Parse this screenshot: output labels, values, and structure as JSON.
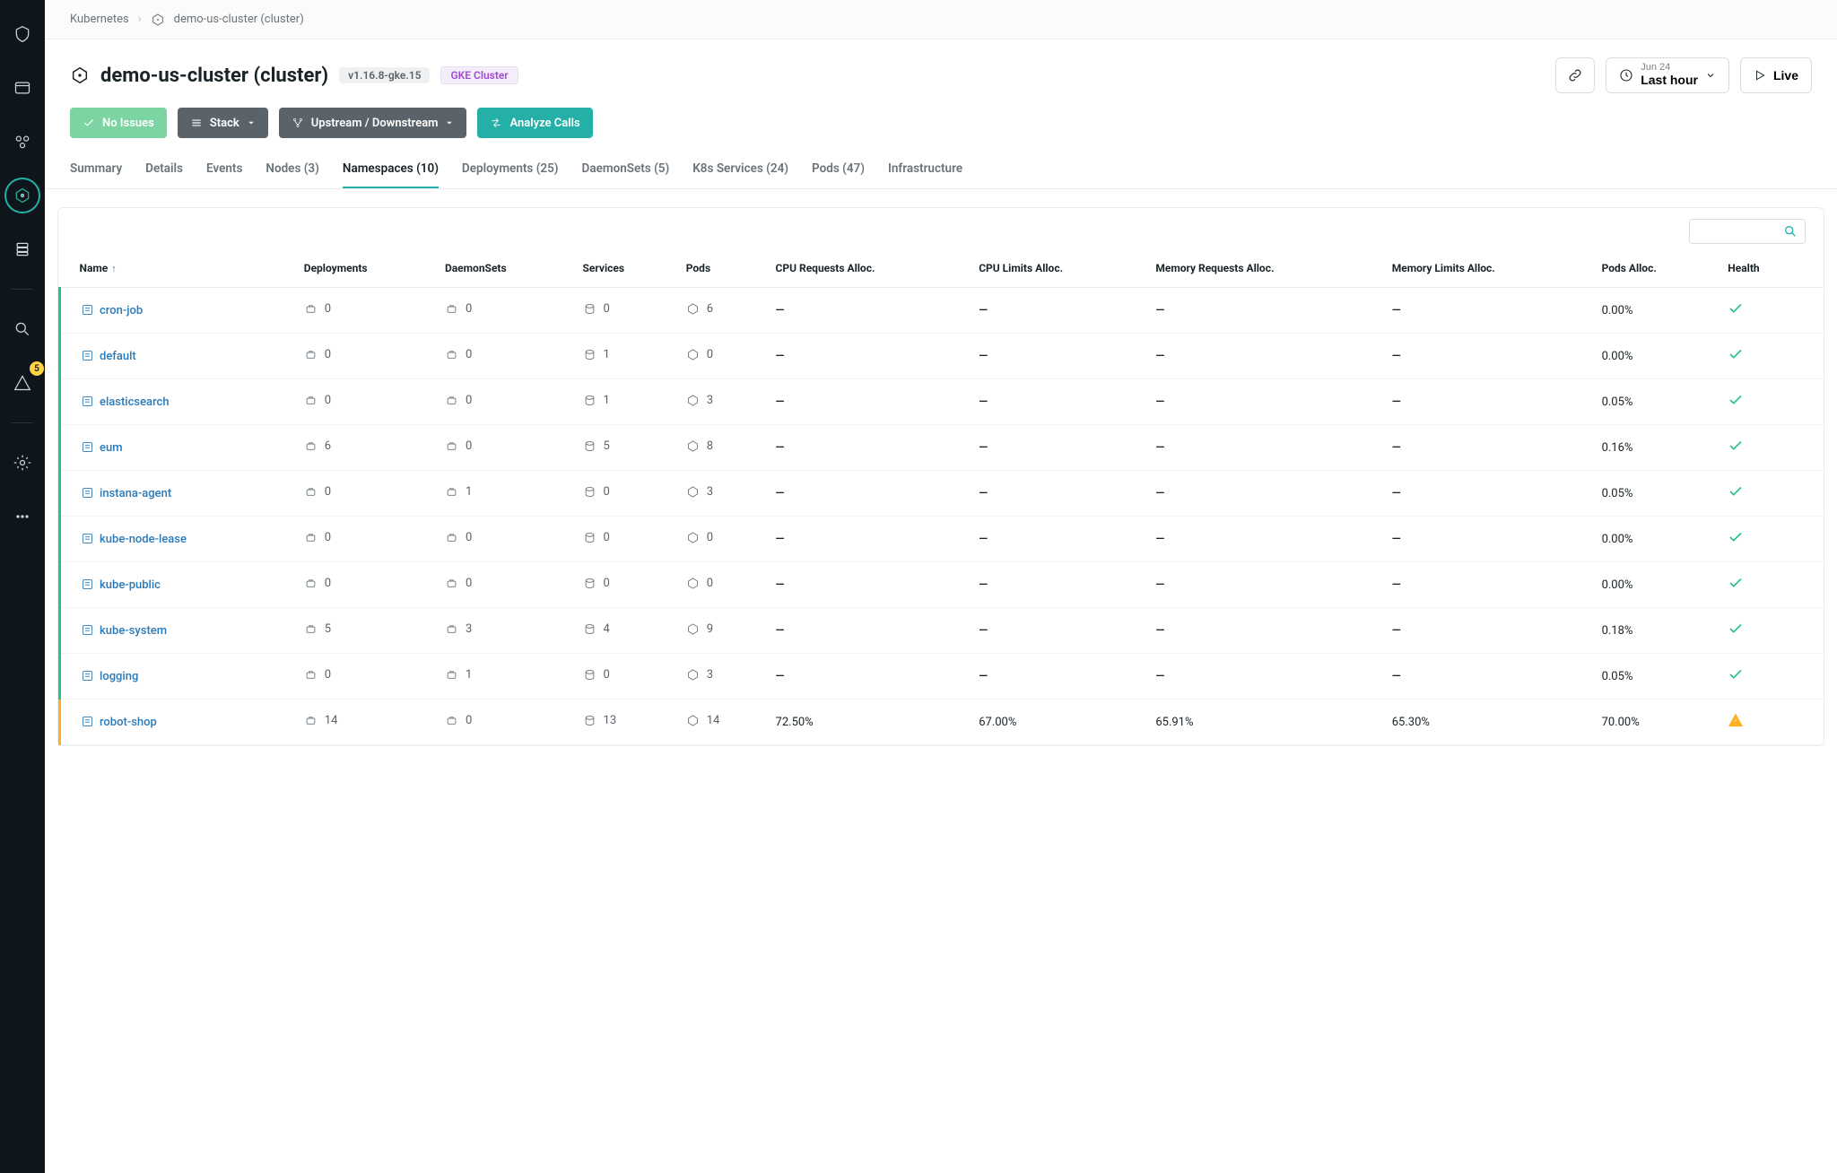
{
  "rail": {
    "badge_count": "5"
  },
  "breadcrumb": {
    "root": "Kubernetes",
    "current": "demo-us-cluster (cluster)"
  },
  "header": {
    "title": "demo-us-cluster (cluster)",
    "version_pill": "v1.16.8-gke.15",
    "type_pill": "GKE Cluster",
    "time": {
      "sup": "Jun 24",
      "main": "Last hour"
    },
    "live_label": "Live"
  },
  "actions": {
    "no_issues": "No Issues",
    "stack": "Stack",
    "upstream": "Upstream / Downstream",
    "analyze": "Analyze Calls"
  },
  "tabs": [
    {
      "label": "Summary",
      "active": false
    },
    {
      "label": "Details",
      "active": false
    },
    {
      "label": "Events",
      "active": false
    },
    {
      "label": "Nodes (3)",
      "active": false
    },
    {
      "label": "Namespaces (10)",
      "active": true
    },
    {
      "label": "Deployments (25)",
      "active": false
    },
    {
      "label": "DaemonSets (5)",
      "active": false
    },
    {
      "label": "K8s Services (24)",
      "active": false
    },
    {
      "label": "Pods (47)",
      "active": false
    },
    {
      "label": "Infrastructure",
      "active": false
    }
  ],
  "table": {
    "columns": {
      "name": "Name",
      "deployments": "Deployments",
      "daemonsets": "DaemonSets",
      "services": "Services",
      "pods": "Pods",
      "cpu_req": "CPU Requests Alloc.",
      "cpu_lim": "CPU Limits Alloc.",
      "mem_req": "Memory Requests Alloc.",
      "mem_lim": "Memory Limits Alloc.",
      "pods_alloc": "Pods Alloc.",
      "health": "Health"
    },
    "rows": [
      {
        "name": "cron-job",
        "deployments": "0",
        "daemonsets": "0",
        "services": "0",
        "pods": "6",
        "cpu_req": "—",
        "cpu_lim": "—",
        "mem_req": "—",
        "mem_lim": "—",
        "pods_alloc": "0.00%",
        "health": "ok"
      },
      {
        "name": "default",
        "deployments": "0",
        "daemonsets": "0",
        "services": "1",
        "pods": "0",
        "cpu_req": "—",
        "cpu_lim": "—",
        "mem_req": "—",
        "mem_lim": "—",
        "pods_alloc": "0.00%",
        "health": "ok"
      },
      {
        "name": "elasticsearch",
        "deployments": "0",
        "daemonsets": "0",
        "services": "1",
        "pods": "3",
        "cpu_req": "—",
        "cpu_lim": "—",
        "mem_req": "—",
        "mem_lim": "—",
        "pods_alloc": "0.05%",
        "health": "ok"
      },
      {
        "name": "eum",
        "deployments": "6",
        "daemonsets": "0",
        "services": "5",
        "pods": "8",
        "cpu_req": "—",
        "cpu_lim": "—",
        "mem_req": "—",
        "mem_lim": "—",
        "pods_alloc": "0.16%",
        "health": "ok"
      },
      {
        "name": "instana-agent",
        "deployments": "0",
        "daemonsets": "1",
        "services": "0",
        "pods": "3",
        "cpu_req": "—",
        "cpu_lim": "—",
        "mem_req": "—",
        "mem_lim": "—",
        "pods_alloc": "0.05%",
        "health": "ok"
      },
      {
        "name": "kube-node-lease",
        "deployments": "0",
        "daemonsets": "0",
        "services": "0",
        "pods": "0",
        "cpu_req": "—",
        "cpu_lim": "—",
        "mem_req": "—",
        "mem_lim": "—",
        "pods_alloc": "0.00%",
        "health": "ok"
      },
      {
        "name": "kube-public",
        "deployments": "0",
        "daemonsets": "0",
        "services": "0",
        "pods": "0",
        "cpu_req": "—",
        "cpu_lim": "—",
        "mem_req": "—",
        "mem_lim": "—",
        "pods_alloc": "0.00%",
        "health": "ok"
      },
      {
        "name": "kube-system",
        "deployments": "5",
        "daemonsets": "3",
        "services": "4",
        "pods": "9",
        "cpu_req": "—",
        "cpu_lim": "—",
        "mem_req": "—",
        "mem_lim": "—",
        "pods_alloc": "0.18%",
        "health": "ok"
      },
      {
        "name": "logging",
        "deployments": "0",
        "daemonsets": "1",
        "services": "0",
        "pods": "3",
        "cpu_req": "—",
        "cpu_lim": "—",
        "mem_req": "—",
        "mem_lim": "—",
        "pods_alloc": "0.05%",
        "health": "ok"
      },
      {
        "name": "robot-shop",
        "deployments": "14",
        "daemonsets": "0",
        "services": "13",
        "pods": "14",
        "cpu_req": "72.50%",
        "cpu_lim": "67.00%",
        "mem_req": "65.91%",
        "mem_lim": "65.30%",
        "pods_alloc": "70.00%",
        "health": "warn"
      }
    ]
  }
}
